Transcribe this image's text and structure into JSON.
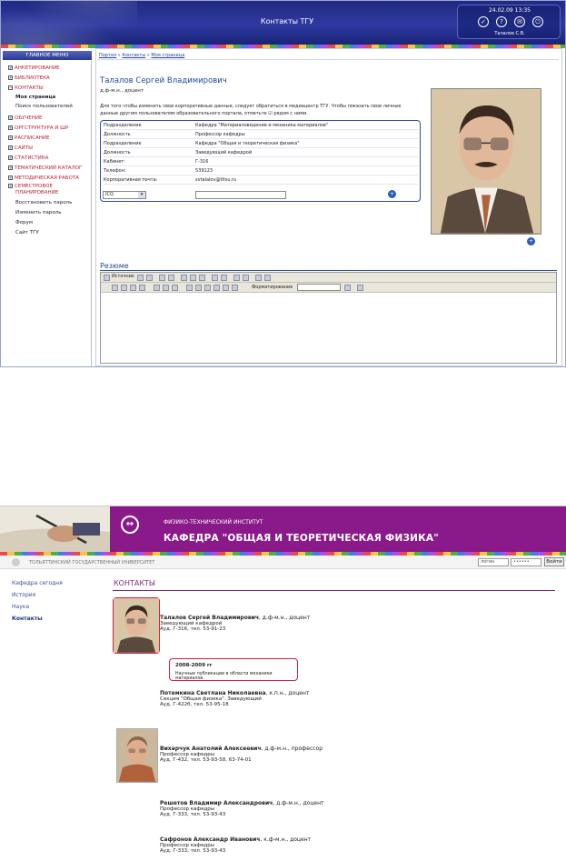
{
  "s1": {
    "title": "Контакты ТГУ",
    "date": "24.02.09 13:35",
    "user": "Талалов С.В.",
    "menu_header": "ГЛАВНОЕ МЕНЮ",
    "menu": [
      "АНКЕТИРОВАНИЕ",
      "БИБЛИОТЕКА",
      "КОНТАКТЫ",
      "ОБУЧЕНИЕ",
      "ОРГСТРУКТУРА И ШР",
      "РАСПИСАНИЕ",
      "САЙТЫ",
      "СТАТИСТИКА",
      "ТЕМАТИЧЕСКИЙ КАТАЛОГ",
      "МЕТОДИЧЕСКАЯ РАБОТА",
      "СЕМЕСТРОВОЕ",
      "ПЛАНИРОВАНИЕ"
    ],
    "menu_box": [
      "+",
      "+",
      "−",
      "+",
      "+",
      "+",
      "+",
      "+",
      "+",
      "+",
      "+"
    ],
    "contacts_sub": [
      "Моя страница",
      "Поиск пользователей"
    ],
    "extra_links": [
      "Восстановить пароль",
      "Изменить пароль",
      "Форум",
      "Сайт ТГУ"
    ],
    "crumbs": [
      "Портал",
      "»",
      "Контакты",
      "»",
      "Моя страница"
    ],
    "name": "Талалов Сергей Владимирович",
    "degree": "д.ф-м.н., доцент",
    "info": "Для того чтобы изменить свои корпоративные данные, следует обратиться в медиацентр ТГУ. Чтобы показать свои личные данные другим пользователям образовательного портала, отметьте ☑ рядом с ними.",
    "rows": [
      {
        "k": "Подразделение",
        "v": "Кафедра \"Материаловедение и механика материалов\""
      },
      {
        "k": "Должность",
        "v": "Профессор кафедры"
      },
      {
        "k": "Подразделение",
        "v": "Кафедра \"Общая и теоретическая физика\""
      },
      {
        "k": "Должность",
        "v": "Заведующий кафедрой"
      },
      {
        "k": "Кабинет:",
        "v": "Г-316"
      },
      {
        "k": "Телефон:",
        "v": "539123"
      },
      {
        "k": "Корпоративная почта:",
        "v": "svtalalov@tltsu.ru"
      }
    ],
    "icq": "ICQ",
    "rezume_title": "Резюме",
    "source_label": "Источник",
    "format_label": "Форматирование"
  },
  "s2": {
    "institute": "ФИЗИКО-ТЕХНИЧЕСКИЙ ИНСТИТУТ",
    "department": "КАФЕДРА \"ОБЩАЯ И ТЕОРЕТИЧЕСКАЯ ФИЗИКА\"",
    "university": "ТОЛЬЯТТИНСКИЙ ГОСУДАРСТВЕННЫЙ УНИВЕРСИТЕТ",
    "login_placeholder": "логин",
    "password_value": "••••••",
    "login_button": "Войти",
    "nav": [
      "Кафедра сегодня",
      "История",
      "Наука",
      "Контакты"
    ],
    "contacts_title": "КОНТАКТЫ",
    "people": [
      {
        "name": "Талалов Сергей Владимирович",
        "degree": ", д.ф-м.н., доцент",
        "line1": "Заведующий кафедрой",
        "line2": "Ауд. Г-316, тел. 53-91-23"
      },
      {
        "name": "Потемкина Светлана Николаевна",
        "degree": ", к.п.н., доцент",
        "line1": "Секция \"Общая физика\". Заведующий",
        "line2": "Ауд. Г-422б, тел. 53-95-18"
      },
      {
        "name": "Вихарчук Анатолий Алексеевич",
        "degree": ", д.ф-м.н., профессор",
        "line1": "Профессор кафедры",
        "line2": "Ауд. Г-432, тел. 53-93-58, 63-74-01"
      },
      {
        "name": "Решетов Владимир Александрович",
        "degree": ", д.ф-м.н., доцент",
        "line1": "Профессор кафедры",
        "line2": "Ауд. Г-333, тел. 53-93-43"
      },
      {
        "name": "Сафронов Александр Иванович",
        "degree": ", к.ф-м.н., доцент",
        "line1": "Профессор кафедры",
        "line2": "Ауд. Г-333, тел. 53-93-43"
      }
    ],
    "pub_year": "2008-2009 гг",
    "pub_text": "Научные публикации в области механики материалов."
  }
}
